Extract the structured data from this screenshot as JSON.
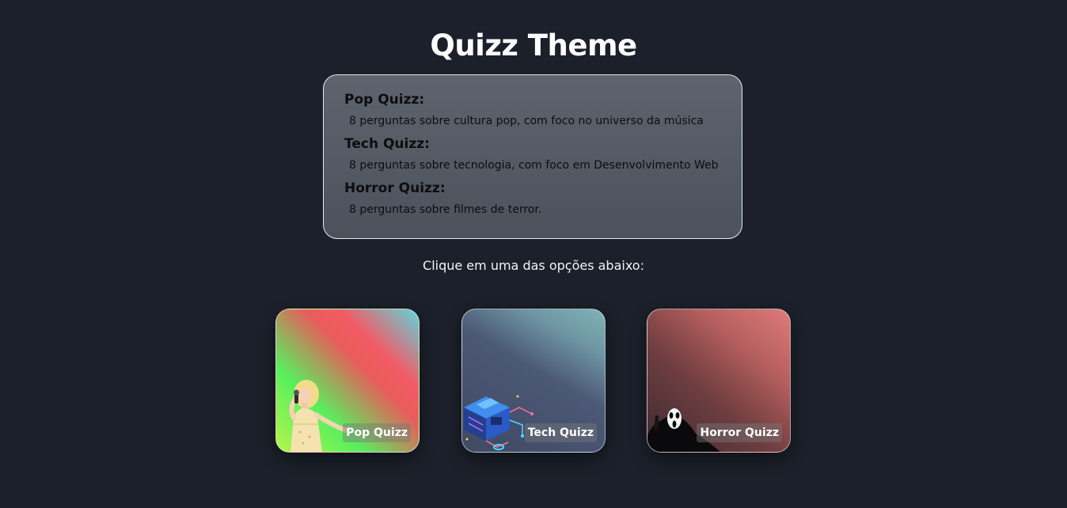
{
  "header": {
    "title": "Quizz Theme"
  },
  "info": {
    "items": [
      {
        "title": "Pop Quizz:",
        "description": "8 perguntas sobre cultura pop, com foco no universo da música"
      },
      {
        "title": "Tech Quizz:",
        "description": "8 perguntas sobre tecnologia, com foco em Desenvolvimento Web"
      },
      {
        "title": "Horror Quizz:",
        "description": "8 perguntas sobre filmes de terror."
      }
    ]
  },
  "prompt": "Clique em uma das opções abaixo:",
  "cards": [
    {
      "label": "Pop Quizz",
      "art": "singer-with-microphone"
    },
    {
      "label": "Tech Quizz",
      "art": "isometric-circuit-cube"
    },
    {
      "label": "Horror Quizz",
      "art": "ghostface-mask"
    }
  ]
}
